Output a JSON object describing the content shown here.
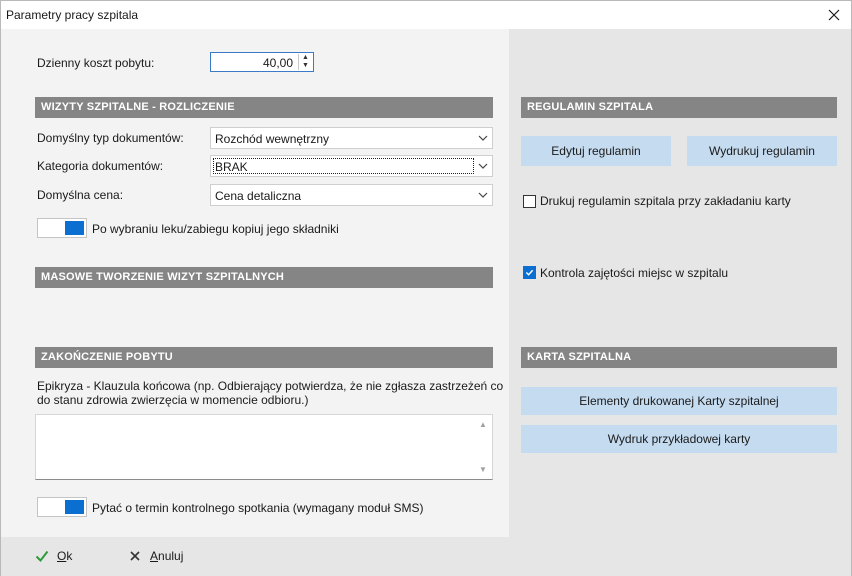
{
  "window": {
    "title": "Parametry pracy szpitala",
    "close_icon": "close-icon"
  },
  "left": {
    "daily_cost": {
      "label": "Dzienny koszt pobytu:",
      "value": "40,00"
    },
    "visits_section": {
      "title": "WIZYTY SZPITALNE - ROZLICZENIE",
      "doc_type": {
        "label": "Domyślny typ dokumentów:",
        "value": "Rozchód wewnętrzny"
      },
      "doc_category": {
        "label": "Kategoria dokumentów:",
        "value": "BRAK"
      },
      "default_price": {
        "label": "Domyślna cena:",
        "value": "Cena detaliczna"
      },
      "copy_components": {
        "label": "Po wybraniu leku/zabiegu kopiuj jego składniki",
        "on": true
      }
    },
    "mass_section": {
      "title": "MASOWE TWORZENIE WIZYT SZPITALNYCH"
    },
    "end_section": {
      "title": "ZAKOŃCZENIE POBYTU",
      "clause_label_line1": "Epikryza - Klauzula końcowa (np. Odbierający potwierdza, że nie zgłasza zastrzeżeń co",
      "clause_label_line2": "do stanu zdrowia zwierzęcia w momencie odbioru.)",
      "clause_value": "",
      "ask_followup": {
        "label": "Pytać o termin kontrolnego spotkania (wymagany moduł SMS)",
        "on": true
      }
    }
  },
  "right": {
    "rules_section": {
      "title": "REGULAMIN SZPITALA",
      "edit_button": "Edytuj regulamin",
      "print_button": "Wydrukuj regulamin",
      "print_on_card": {
        "label": "Drukuj regulamin szpitala przy zakładaniu karty",
        "checked": false
      },
      "occupancy_control": {
        "label": "Kontrola zajętości miejsc w szpitalu",
        "checked": true
      }
    },
    "card_section": {
      "title": "KARTA SZPITALNA",
      "elements_button": "Elementy drukowanej Karty szpitalnej",
      "sample_button": "Wydruk przykładowej karty"
    }
  },
  "footer": {
    "ok_label": "Ok",
    "cancel_label": "Anuluj"
  },
  "colors": {
    "accent": "#0b6fd1",
    "section_bg": "#858585",
    "button_bg": "#c5dbf0",
    "ok_icon": "#2e9b3a"
  }
}
